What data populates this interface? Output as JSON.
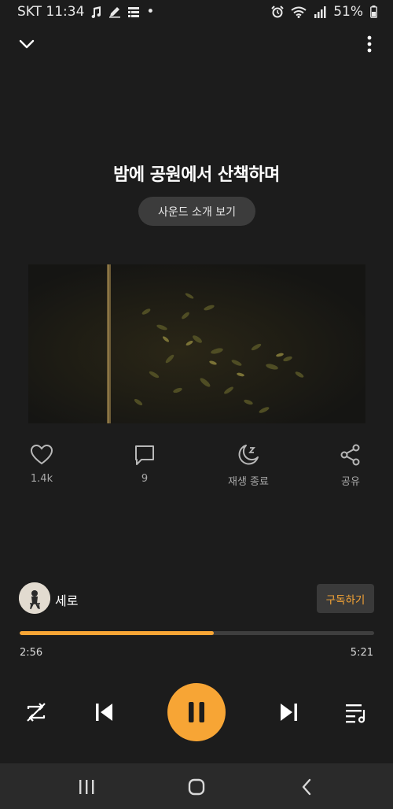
{
  "status_bar": {
    "carrier_time": "SKT 11:34",
    "dot": "•",
    "battery": "51%",
    "icons_left": [
      "music-note-icon",
      "edit-icon",
      "list-icon"
    ],
    "icons_right": [
      "alarm-icon",
      "wifi-icon",
      "signal-icon",
      "battery-icon"
    ]
  },
  "header": {
    "collapse_icon": "chevron-down-icon",
    "more_icon": "more-vertical-icon"
  },
  "track": {
    "title": "밤에 공원에서 산책하며",
    "intro_button": "사운드 소개 보기"
  },
  "actions": [
    {
      "icon": "heart-icon",
      "label": "1.4k"
    },
    {
      "icon": "comment-icon",
      "label": "9"
    },
    {
      "icon": "sleep-timer-icon",
      "label": "재생 종료"
    },
    {
      "icon": "share-icon",
      "label": "공유"
    }
  ],
  "artist": {
    "name": "세로",
    "subscribe_label": "구독하기"
  },
  "playback": {
    "current_time": "2:56",
    "total_time": "5:21",
    "progress": 0.548
  },
  "controls": {
    "icons": [
      "repeat-off-icon",
      "skip-previous-icon",
      "pause-icon",
      "skip-next-icon",
      "playlist-icon"
    ]
  },
  "colors": {
    "accent": "#f7a535",
    "background": "#1c1c1c",
    "text_secondary": "#a8a8a8"
  },
  "nav_bar": {
    "icons": [
      "recents-icon",
      "home-icon",
      "back-icon"
    ]
  }
}
